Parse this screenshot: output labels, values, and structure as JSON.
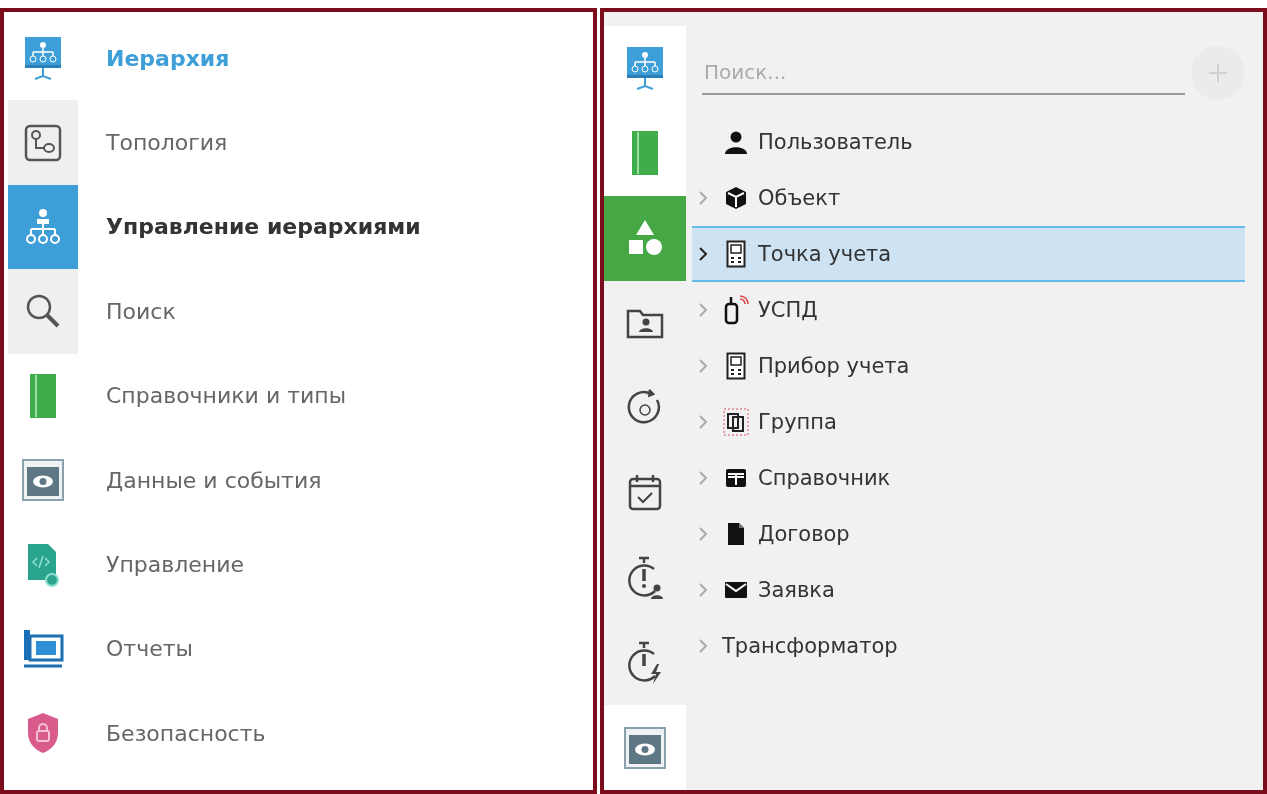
{
  "menu": {
    "header": {
      "label": "Иерархия"
    },
    "items": [
      {
        "label": "Топология",
        "selected": false,
        "shaded": true
      },
      {
        "label": "Управление иерархиями",
        "selected": true,
        "shaded": false
      },
      {
        "label": "Поиск",
        "selected": false,
        "shaded": true
      },
      {
        "label": "Справочники и типы",
        "selected": false,
        "shaded": false
      },
      {
        "label": "Данные и события",
        "selected": false,
        "shaded": false
      },
      {
        "label": "Управление",
        "selected": false,
        "shaded": false
      },
      {
        "label": "Отчеты",
        "selected": false,
        "shaded": false
      },
      {
        "label": "Безопасность",
        "selected": false,
        "shaded": false
      }
    ]
  },
  "rail": [
    {
      "selected": false,
      "shaded": false
    },
    {
      "selected": false,
      "shaded": false
    },
    {
      "selected": true,
      "shaded": false
    },
    {
      "selected": false,
      "shaded": true
    },
    {
      "selected": false,
      "shaded": true
    },
    {
      "selected": false,
      "shaded": true
    },
    {
      "selected": false,
      "shaded": true
    },
    {
      "selected": false,
      "shaded": true
    },
    {
      "selected": false,
      "shaded": false
    }
  ],
  "search": {
    "placeholder": "Поиск..."
  },
  "tree": [
    {
      "label": "Пользователь",
      "kind": "user",
      "expandable": false,
      "selected": false
    },
    {
      "label": "Объект",
      "kind": "cube",
      "expandable": true,
      "selected": false
    },
    {
      "label": "Точка учета",
      "kind": "meter",
      "expandable": true,
      "selected": true
    },
    {
      "label": "УСПД",
      "kind": "device",
      "expandable": true,
      "selected": false
    },
    {
      "label": "Прибор учета",
      "kind": "meter",
      "expandable": true,
      "selected": false
    },
    {
      "label": "Группа",
      "kind": "group",
      "expandable": true,
      "selected": false
    },
    {
      "label": "Справочник",
      "kind": "table",
      "expandable": true,
      "selected": false
    },
    {
      "label": "Договор",
      "kind": "document",
      "expandable": true,
      "selected": false
    },
    {
      "label": "Заявка",
      "kind": "mail",
      "expandable": true,
      "selected": false
    },
    {
      "label": "Трансформатор",
      "kind": "none",
      "expandable": true,
      "selected": false
    }
  ]
}
